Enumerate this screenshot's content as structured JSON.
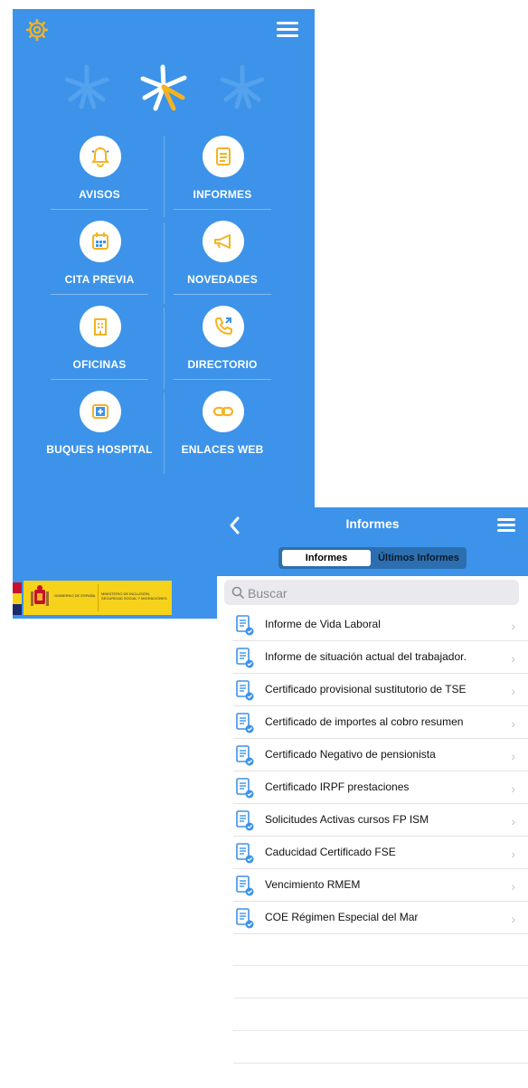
{
  "home": {
    "menu_items": [
      {
        "label": "AVISOS",
        "icon": "bell-icon"
      },
      {
        "label": "INFORMES",
        "icon": "document-icon"
      },
      {
        "label": "CITA PREVIA",
        "icon": "calendar-icon"
      },
      {
        "label": "NOVEDADES",
        "icon": "megaphone-icon"
      },
      {
        "label": "OFICINAS",
        "icon": "building-icon"
      },
      {
        "label": "DIRECTORIO",
        "icon": "phone-icon"
      },
      {
        "label": "BUQUES HOSPITAL",
        "icon": "medical-kit-icon"
      },
      {
        "label": "ENLACES WEB",
        "icon": "link-icon"
      }
    ],
    "gov_left": "GOBIERNO DE ESPAÑA",
    "gov_right": "MINISTERIO DE INCLUSIÓN, SEGURIDAD SOCIAL Y MIGRACIONES"
  },
  "informes": {
    "title": "Informes",
    "tabs": [
      "Informes",
      "Últimos Informes"
    ],
    "search_placeholder": "Buscar",
    "items": [
      "Informe de Vida Laboral",
      "Informe de situación actual del trabajador.",
      "Certificado provisional sustitutorio de TSE",
      "Certificado de importes al cobro resumen",
      "Certificado Negativo de pensionista",
      "Certificado IRPF prestaciones",
      "Solicitudes Activas cursos FP ISM",
      "Caducidad Certificado FSE",
      "Vencimiento RMEM",
      "COE Régimen Especial del Mar"
    ]
  },
  "colors": {
    "primary": "#3c93e9",
    "accent": "#f4b321",
    "gov_yellow": "#f6d21b"
  }
}
